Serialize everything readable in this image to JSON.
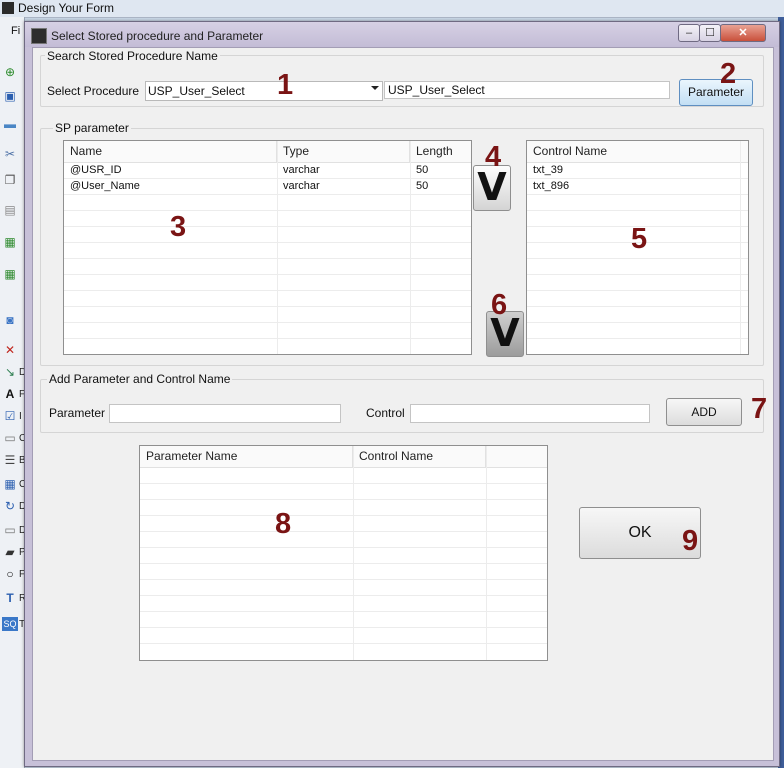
{
  "background_app": {
    "title": "Design  Your Form",
    "menu_initial": "Fi",
    "toolbox_letters": [
      "D",
      "F",
      "I",
      "C",
      "B",
      "C",
      "D",
      "D",
      "P",
      "F",
      "R",
      "T"
    ]
  },
  "dialog": {
    "title": "Select Stored procedure and Parameter",
    "caption_buttons": {
      "minimize": "‒",
      "maximize": "☐",
      "close": "✕"
    }
  },
  "search_group": {
    "label": "Search Stored Procedure Name",
    "select_label": "Select Procedure",
    "procedure_combo_value": "USP_User_Select",
    "procedure_text_value": "USP_User_Select",
    "parameter_button": "Parameter"
  },
  "sp_group": {
    "label": "SP parameter",
    "params_table": {
      "columns": [
        "Name",
        "Type",
        "Length"
      ],
      "rows": [
        [
          "@USR_ID",
          "varchar",
          "50"
        ],
        [
          "@User_Name",
          "varchar",
          "50"
        ]
      ]
    },
    "arrow_button_top": "V",
    "arrow_button_bottom": "V",
    "controls_table": {
      "columns": [
        "Control Name"
      ],
      "rows": [
        [
          "txt_39"
        ],
        [
          "txt_896"
        ]
      ]
    }
  },
  "add_group": {
    "label": "Add Parameter and Control  Name",
    "parameter_label": "Parameter",
    "parameter_value": "",
    "control_label": "Control",
    "control_value": "",
    "add_button": "ADD"
  },
  "mapping_table": {
    "columns": [
      "Parameter Name",
      "Control Name"
    ]
  },
  "ok_button": "OK",
  "callouts": [
    "1",
    "2",
    "3",
    "4",
    "5",
    "6",
    "7",
    "8",
    "9"
  ],
  "colors": {
    "callout": "#7a1414",
    "dialog_frame": "#c7c0d8"
  }
}
